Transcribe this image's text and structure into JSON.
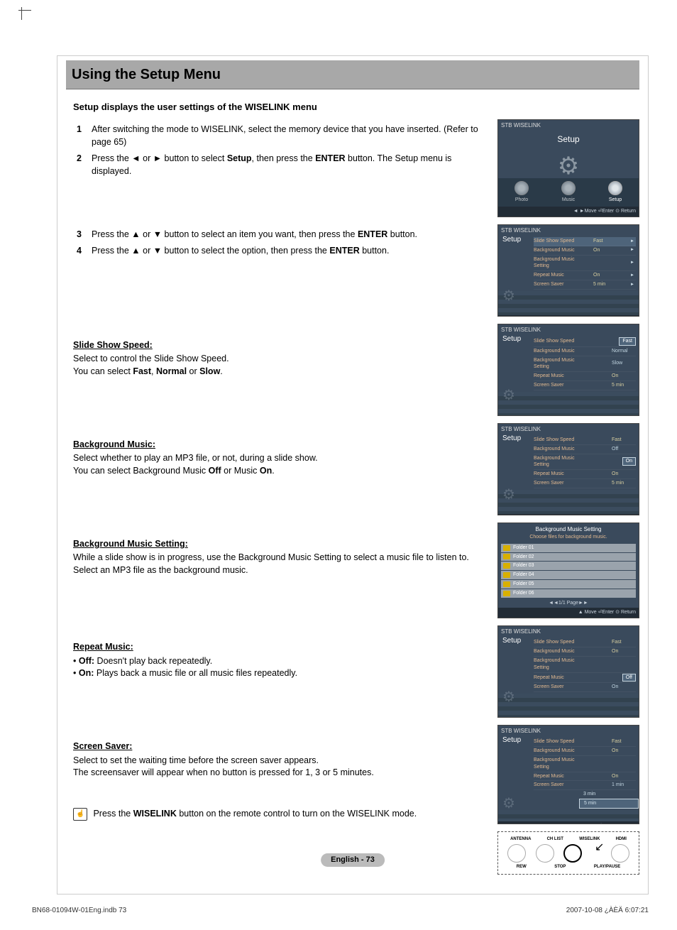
{
  "page": {
    "title": "Using the Setup Menu",
    "subtitle": "Setup displays the user settings of the WISELINK menu",
    "footer_badge": "English - 73",
    "footer_left": "BN68-01094W-01Eng.indb   73",
    "footer_right": "2007-10-08   ¿ÀÈÄ 6:07:21"
  },
  "steps": {
    "s1": {
      "num": "1",
      "body": "After switching the mode to WISELINK, select the memory device that you have inserted. (Refer to page 65)"
    },
    "s2": {
      "num": "2",
      "body_pre": "Press the ◄ or ► button to select ",
      "body_bold1": "Setup",
      "body_mid": ", then press the ",
      "body_bold2": "ENTER",
      "body_post": " button. The Setup menu is displayed."
    },
    "s3": {
      "num": "3",
      "body_pre": "Press the ▲ or ▼ button to select an item you want, then press the ",
      "body_bold": "ENTER",
      "body_post": " button."
    },
    "s4": {
      "num": "4",
      "body_pre": "Press the ▲ or ▼ button to select the option, then press the ",
      "body_bold": "ENTER",
      "body_post": " button."
    }
  },
  "sections": {
    "slideshow": {
      "heading": "Slide Show Speed:",
      "line1": "Select to control the Slide Show Speed.",
      "line2_pre": "You can select ",
      "line2_b1": "Fast",
      "line2_m1": ", ",
      "line2_b2": "Normal",
      "line2_m2": " or ",
      "line2_b3": "Slow",
      "line2_post": "."
    },
    "bgm": {
      "heading": "Background Music:",
      "line1": "Select whether to play an MP3 file, or not, during a slide show.",
      "line2_pre": "You can select Background Music ",
      "line2_b1": "Off",
      "line2_m1": " or Music ",
      "line2_b2": "On",
      "line2_post": "."
    },
    "bgms": {
      "heading": "Background Music Setting:",
      "line1": "While a slide show is in progress, use the Background Music Setting to select a music file to listen to.",
      "line2": "Select an MP3 file as the background music."
    },
    "repeat": {
      "heading": "Repeat Music:",
      "b1_label": "Off:",
      "b1_text": " Doesn't play back repeatedly.",
      "b2_label": "On:",
      "b2_text": " Plays back a music file or all music files repeatedly."
    },
    "saver": {
      "heading": "Screen Saver:",
      "line1": "Select to set the waiting time before the screen saver appears.",
      "line2": "The screensaver will appear when no button is pressed for 1, 3 or 5 minutes."
    }
  },
  "tip": {
    "icon": "☝",
    "text_pre": "Press the ",
    "text_bold": "WISELINK",
    "text_post": " button on the remote control to turn on the WISELINK mode."
  },
  "shots": {
    "hdr": "STB\nWISELINK",
    "footbar_main": "◄ ►Move    ⏎Enter   ⊙ Return",
    "footbar_setup": "▲ Move    ⏎Enter   ⊙ Return",
    "nav_page": "◄◄1/1 Page►►",
    "main": {
      "title": "Setup",
      "tabs": [
        "Photo",
        "Music",
        "Setup"
      ]
    },
    "setup_labels": {
      "r1": "Slide Show Speed",
      "r2": "Background Music",
      "r3": "Background Music Setting",
      "r4": "Repeat Music",
      "r5": "Screen Saver"
    },
    "setup_vals_default": {
      "r1": "Fast",
      "r2": "On",
      "r4": "On",
      "r5": "5 min"
    },
    "slideshow_opts": [
      "Fast",
      "Normal",
      "Slow"
    ],
    "bgm_opts": [
      "On",
      "Off"
    ],
    "repeat_opts": [
      "Off",
      "On"
    ],
    "saver_opts": [
      "1 min",
      "3 min",
      "5 min"
    ],
    "bms": {
      "title": "Background Music Setting",
      "sub": "Choose files for background music.",
      "folders": [
        "Folder 01",
        "Folder 02",
        "Folder 03",
        "Folder 04",
        "Folder 05",
        "Folder 06"
      ]
    },
    "remote": {
      "top": [
        "ANTENNA",
        "CH LIST",
        "WISELINK",
        "HDMI"
      ],
      "bottom": [
        "REW",
        "STOP",
        "PLAY/PAUSE"
      ]
    }
  }
}
